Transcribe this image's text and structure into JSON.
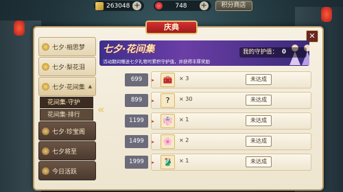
{
  "currency": {
    "gold": "263048",
    "ruby": "748",
    "shop_label": "积分商店"
  },
  "panel_title": "庆典",
  "sidebar": {
    "items": [
      {
        "label": "七夕·相思梦",
        "open": false
      },
      {
        "label": "七夕·梨花泪",
        "open": false
      },
      {
        "label": "七夕·花间集",
        "open": true
      },
      {
        "label": "七夕·珍宝阁",
        "open": false
      },
      {
        "label": "七夕将至",
        "open": false
      },
      {
        "label": "今日活跃",
        "open": false
      }
    ],
    "sub_items": [
      {
        "label": "花间集·守护",
        "active": true
      },
      {
        "label": "花间集·排行",
        "active": false
      }
    ]
  },
  "banner": {
    "title": "七夕·花间集",
    "description": "活动期间赠送七夕礼物可累积守护值，并获得丰厚奖励"
  },
  "guard_value": {
    "label": "我的守护值：",
    "value": "0"
  },
  "rewards": [
    {
      "threshold": "699",
      "icon": "treasure-chest-icon",
      "glyph": "🧰",
      "qty": "× 3",
      "status": "未达成"
    },
    {
      "threshold": "899",
      "icon": "mystery-item-icon",
      "glyph": "?",
      "qty": "× 30",
      "status": "未达成"
    },
    {
      "threshold": "1199",
      "icon": "purple-character-icon",
      "glyph": "👘",
      "qty": "× 1",
      "status": "未达成"
    },
    {
      "threshold": "1499",
      "icon": "flower-character-icon",
      "glyph": "🌸",
      "qty": "× 2",
      "status": "未达成"
    },
    {
      "threshold": "1999",
      "icon": "teal-outfit-icon",
      "glyph": "🥻",
      "qty": "× 1",
      "status": "未达成"
    }
  ]
}
